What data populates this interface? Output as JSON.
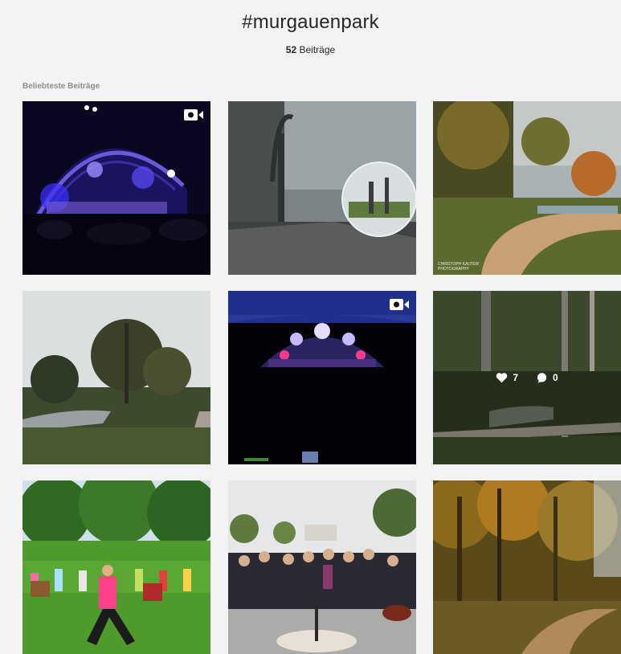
{
  "header": {
    "hashtag": "#murgauenpark",
    "post_count": "52",
    "post_count_label": "Beiträge"
  },
  "top_posts": {
    "label": "Beliebteste Beiträge"
  },
  "posts": [
    {
      "name": "post-concert-stage",
      "type": "video"
    },
    {
      "name": "post-crystal-ball",
      "type": "image"
    },
    {
      "name": "post-autumn-path",
      "type": "image",
      "watermark_line1": "CHRISTOPH KAUTER",
      "watermark_line2": "PHOTOGRAPHY"
    },
    {
      "name": "post-river-trees",
      "type": "image"
    },
    {
      "name": "post-tent-concert",
      "type": "video"
    },
    {
      "name": "post-forest-stream",
      "type": "image",
      "likes": "7",
      "comments": "0"
    },
    {
      "name": "post-fitness-group",
      "type": "image"
    },
    {
      "name": "post-group-photo",
      "type": "image"
    },
    {
      "name": "post-autumn-forest",
      "type": "image"
    }
  ],
  "icons": {
    "video": "video-camera-icon",
    "like": "heart-icon",
    "comment": "comment-icon"
  }
}
